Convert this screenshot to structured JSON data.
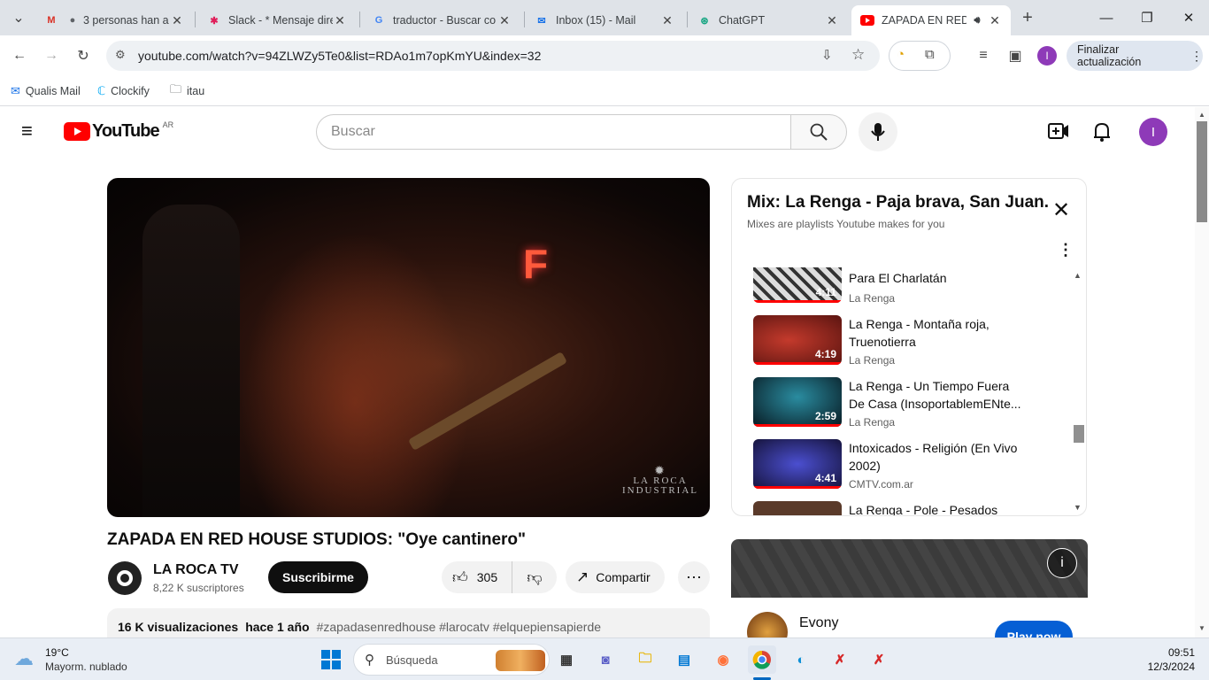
{
  "browser": {
    "tabs": [
      {
        "title": "3 personas han a",
        "icon": "gmail-icon"
      },
      {
        "title": "Slack - * Mensaje dire",
        "icon": "slack-icon"
      },
      {
        "title": "traductor - Buscar co",
        "icon": "google-icon"
      },
      {
        "title": "Inbox (15) - Mail",
        "icon": "mail-icon"
      },
      {
        "title": "ChatGPT",
        "icon": "chatgpt-icon"
      },
      {
        "title": "ZAPADA EN RED",
        "icon": "youtube-icon"
      }
    ],
    "url": "youtube.com/watch?v=94ZLWZy5Te0&list=RDAo1m7opKmYU&index=32",
    "update_button": "Finalizar actualización",
    "profile_initial": "I",
    "bookmarks": [
      "Qualis Mail",
      "Clockify",
      "itau"
    ]
  },
  "youtube": {
    "logo_text": "YouTube",
    "country": "AR",
    "search_placeholder": "Buscar",
    "avatar_initial": "I"
  },
  "video": {
    "title": "ZAPADA EN RED HOUSE STUDIOS: \"Oye cantinero\"",
    "watermark": "LA ROCA INDUSTRIAL",
    "channel": "LA ROCA TV",
    "subscribers": "8,22 K suscriptores",
    "subscribe_label": "Suscribirme",
    "likes": "305",
    "share_label": "Compartir",
    "views": "16 K visualizaciones",
    "age": "hace 1 año",
    "hashtags": "#zapadasenredhouse #larocatv #elquepiensapierde"
  },
  "playlist": {
    "title": "Mix: La Renga - Paja brava, San Juan...",
    "subtitle": "Mixes are playlists Youtube makes for you",
    "items": [
      {
        "title": "Para El Charlatán",
        "channel": "La Renga",
        "duration": "4:11"
      },
      {
        "title": "La Renga - Montaña roja, Truenotierra",
        "channel": "La Renga",
        "duration": "4:19"
      },
      {
        "title": "La Renga - Un Tiempo Fuera De Casa (InsoportablemENte...",
        "channel": "La Renga",
        "duration": "2:59"
      },
      {
        "title": "Intoxicados - Religión (En Vivo 2002)",
        "channel": "CMTV.com.ar",
        "duration": "4:41"
      },
      {
        "title": "La Renga - Pole - Pesados",
        "channel": "",
        "duration": ""
      }
    ]
  },
  "ad": {
    "advertiser": "Evony",
    "cta": "Play now"
  },
  "taskbar": {
    "weather_temp": "19°C",
    "weather_desc": "Mayorm. nublado",
    "search_placeholder": "Búsqueda",
    "time": "09:51",
    "date": "12/3/2024"
  }
}
